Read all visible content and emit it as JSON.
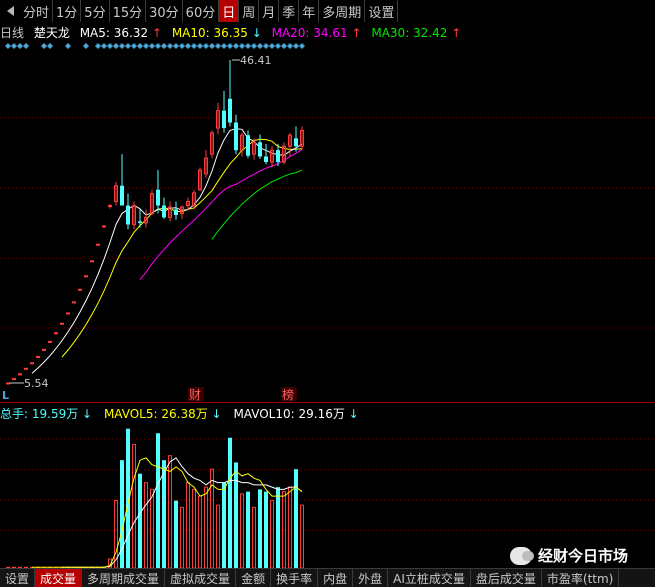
{
  "toolbar": {
    "periods": [
      "分时",
      "1分",
      "5分",
      "15分",
      "30分",
      "60分",
      "日",
      "周",
      "月",
      "季",
      "年",
      "多周期"
    ],
    "active": "日",
    "settings": "设置"
  },
  "legend": {
    "period": "日线",
    "stock": "楚天龙",
    "ma5": "MA5: 36.32",
    "ma10": "MA10: 36.35",
    "ma20": "MA20: 34.61",
    "ma30": "MA30: 32.42"
  },
  "colors": {
    "up": "#ff3c3c",
    "down": "#54ffff",
    "ma5": "#ffffff",
    "ma10": "#ffff00",
    "ma20": "#ff00ff",
    "ma30": "#00e600",
    "background": "#000000",
    "active_tab": "#b40000"
  },
  "price_labels": {
    "high": "46.41",
    "low": "5.54",
    "marker_l": "L",
    "event_1": "财",
    "event_2": "榜"
  },
  "volume_legend": {
    "total": "总手: 19.59万",
    "mavol5": "MAVOL5: 26.38万",
    "mavol10": "MAVOL10: 29.16万"
  },
  "bottom_tabs": [
    "设置",
    "成交量",
    "多周期成交量",
    "虚拟成交量",
    "金额",
    "换手率",
    "内盘",
    "外盘",
    "AI立桩成交量",
    "盘后成交量",
    "市盈率(ttm)"
  ],
  "bottom_active": "成交量",
  "watermark": "经财今日市场",
  "chart_data": {
    "type": "candlestick",
    "ohlc": [
      [
        5.54,
        5.54,
        5.54,
        5.54
      ],
      [
        6.1,
        6.1,
        6.1,
        6.1
      ],
      [
        6.7,
        6.7,
        6.7,
        6.7
      ],
      [
        7.4,
        7.4,
        7.4,
        7.4
      ],
      [
        8.1,
        8.1,
        8.1,
        8.1
      ],
      [
        8.9,
        8.9,
        8.9,
        8.9
      ],
      [
        9.8,
        9.8,
        9.8,
        9.8
      ],
      [
        10.8,
        10.8,
        10.8,
        10.8
      ],
      [
        11.9,
        11.9,
        11.9,
        11.9
      ],
      [
        13.1,
        13.1,
        13.1,
        13.1
      ],
      [
        14.4,
        14.4,
        14.4,
        14.4
      ],
      [
        15.8,
        15.8,
        15.8,
        15.8
      ],
      [
        17.4,
        17.4,
        17.4,
        17.4
      ],
      [
        19.1,
        19.1,
        19.1,
        19.1
      ],
      [
        21.0,
        21.0,
        21.0,
        21.0
      ],
      [
        23.1,
        23.1,
        23.1,
        23.1
      ],
      [
        25.4,
        25.4,
        25.4,
        25.4
      ],
      [
        27.9,
        28.2,
        27.6,
        28.0
      ],
      [
        28.5,
        31.0,
        28.0,
        30.5
      ],
      [
        30.5,
        34.5,
        28.0,
        28.0
      ],
      [
        28.0,
        29.5,
        25.0,
        25.6
      ],
      [
        25.6,
        28.5,
        25.0,
        28.0
      ],
      [
        26.0,
        27.5,
        25.2,
        25.8
      ],
      [
        25.8,
        27.5,
        25.2,
        26.5
      ],
      [
        27.0,
        30.0,
        26.8,
        29.5
      ],
      [
        30.0,
        32.5,
        27.0,
        28.0
      ],
      [
        28.0,
        29.0,
        26.3,
        26.5
      ],
      [
        26.5,
        28.5,
        26.0,
        27.8
      ],
      [
        27.5,
        28.5,
        26.2,
        26.8
      ],
      [
        27.0,
        28.0,
        26.3,
        27.8
      ],
      [
        28.0,
        29.0,
        27.4,
        28.5
      ],
      [
        28.0,
        30.0,
        27.5,
        29.6
      ],
      [
        30.0,
        32.8,
        29.8,
        32.5
      ],
      [
        32.0,
        35.0,
        31.5,
        34.0
      ],
      [
        34.5,
        37.5,
        34.0,
        37.2
      ],
      [
        37.8,
        41.0,
        37.0,
        40.0
      ],
      [
        40.0,
        42.5,
        37.2,
        37.8
      ],
      [
        41.5,
        46.41,
        38.0,
        38.5
      ],
      [
        38.5,
        39.5,
        34.5,
        35.0
      ],
      [
        35.0,
        37.2,
        34.2,
        36.9
      ],
      [
        36.9,
        37.5,
        34.0,
        34.3
      ],
      [
        34.5,
        36.5,
        33.8,
        36.0
      ],
      [
        36.0,
        37.0,
        33.9,
        34.2
      ],
      [
        34.2,
        35.8,
        33.2,
        33.5
      ],
      [
        33.5,
        35.5,
        32.8,
        35.0
      ],
      [
        35.0,
        35.8,
        33.0,
        33.5
      ],
      [
        33.5,
        36.0,
        33.2,
        35.5
      ],
      [
        35.5,
        37.2,
        34.2,
        36.9
      ],
      [
        36.5,
        38.0,
        34.8,
        35.5
      ],
      [
        35.5,
        38.0,
        35.0,
        37.5
      ]
    ],
    "volume": [
      0.3,
      0.3,
      0.3,
      0.3,
      0.3,
      0.3,
      0.3,
      0.3,
      0.3,
      0.3,
      0.3,
      0.3,
      0.3,
      0.3,
      0.3,
      0.3,
      0.4,
      4,
      30,
      48,
      62,
      55,
      42,
      38,
      35,
      60,
      48,
      50,
      30,
      27,
      38,
      35,
      32,
      36,
      44,
      28,
      38,
      58,
      47,
      33,
      34,
      27,
      35,
      34,
      30,
      36,
      34,
      36,
      44,
      28
    ],
    "mavol5": [
      null,
      null,
      null,
      null,
      0.3,
      0.3,
      0.3,
      0.3,
      0.3,
      0.3,
      0.3,
      0.3,
      0.3,
      0.3,
      0.3,
      0.3,
      0.3,
      1.1,
      7.0,
      16.6,
      28.9,
      40.0,
      48.0,
      49.0,
      46.0,
      45.0,
      44.0,
      43.0,
      45.0,
      43.0,
      38.0,
      36.0,
      32.0,
      33.0,
      37.0,
      35.0,
      35.0,
      40.0,
      43.0,
      41.0,
      42.0,
      40.0,
      39.0,
      35.0,
      32.0,
      32.0,
      32.0,
      34.0,
      36.0,
      34.0
    ],
    "mavol10": [
      null,
      null,
      null,
      null,
      null,
      null,
      null,
      null,
      null,
      0.3,
      0.3,
      0.3,
      0.3,
      0.3,
      0.3,
      0.3,
      0.3,
      0.7,
      3.7,
      8.5,
      14.7,
      20.2,
      24.4,
      28.2,
      31.7,
      37.6,
      42.4,
      47.3,
      49.0,
      45.2,
      42.0,
      40.0,
      39.0,
      37.0,
      39.0,
      38.0,
      38.0,
      39.0,
      39.0,
      38.0,
      38.0,
      37.0,
      37.0,
      37.0,
      36.0,
      35.0,
      35.0,
      36.0,
      36.0,
      34.0
    ],
    "ylim_price": [
      5.54,
      46.41
    ],
    "ylim_volume": [
      0,
      65
    ]
  }
}
